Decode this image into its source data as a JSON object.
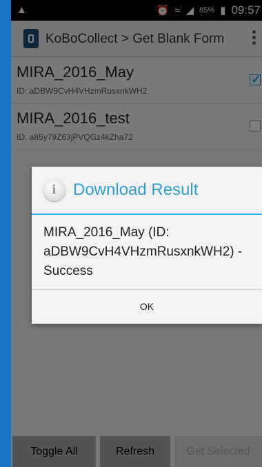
{
  "status_bar": {
    "battery": "85%",
    "time": "09:57",
    "icons": [
      "notification-icon",
      "alarm-icon",
      "wifi-icon",
      "signal-icon",
      "battery-icon"
    ]
  },
  "action_bar": {
    "title": "KoBoCollect > Get Blank Form"
  },
  "forms": [
    {
      "title": "MIRA_2016_May",
      "id": "ID: aDBW9CvH4VHzmRusxnkWH2",
      "checked": true
    },
    {
      "title": "MIRA_2016_test",
      "id": "ID: a85y79Z63jPVQGz4kZha72",
      "checked": false
    }
  ],
  "dialog": {
    "title": "Download Result",
    "message": "MIRA_2016_May (ID: aDBW9CvH4VHzmRusxnkWH2) - Success",
    "ok_label": "OK"
  },
  "buttons": {
    "toggle_all": "Toggle All",
    "refresh": "Refresh",
    "get_selected": "Get Selected"
  },
  "colors": {
    "accent": "#33b5e5",
    "dialog_title": "#2f9fd6",
    "background_border": "#1976c7"
  }
}
